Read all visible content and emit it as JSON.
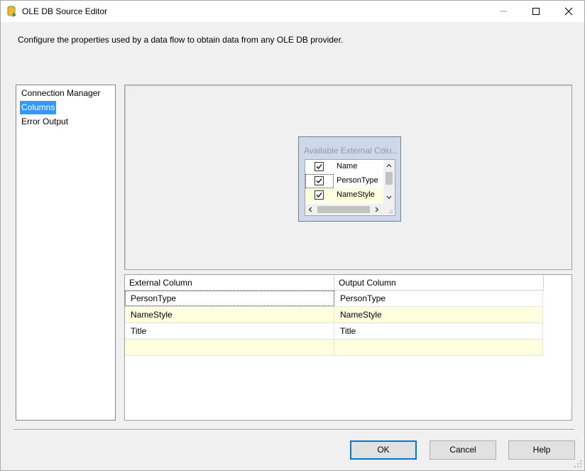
{
  "window": {
    "title": "OLE DB Source Editor",
    "icon": "database-source-icon"
  },
  "titlebar_buttons": [
    "minimize-icon",
    "maximize-icon",
    "close-icon"
  ],
  "description": "Configure the properties used by a data flow to obtain data from any OLE DB provider.",
  "nav": {
    "items": [
      {
        "label": "Connection Manager",
        "selected": false
      },
      {
        "label": "Columns",
        "selected": true
      },
      {
        "label": "Error Output",
        "selected": false
      }
    ]
  },
  "available_columns": {
    "title": "Available External Colu...",
    "items": [
      {
        "label": "Name",
        "checked": true
      },
      {
        "label": "PersonType",
        "checked": true
      },
      {
        "label": "NameStyle",
        "checked": true
      }
    ]
  },
  "mapping_grid": {
    "headers": [
      "External Column",
      "Output Column"
    ],
    "rows": [
      {
        "external": "PersonType",
        "output": "PersonType"
      },
      {
        "external": "NameStyle",
        "output": "NameStyle"
      },
      {
        "external": "Title",
        "output": "Title"
      },
      {
        "external": "",
        "output": ""
      }
    ]
  },
  "buttons": {
    "ok": "OK",
    "cancel": "Cancel",
    "help": "Help"
  },
  "colors": {
    "selection": "#3399ff",
    "alt_row": "#ffffe0",
    "default_button_border": "#0078d7"
  }
}
